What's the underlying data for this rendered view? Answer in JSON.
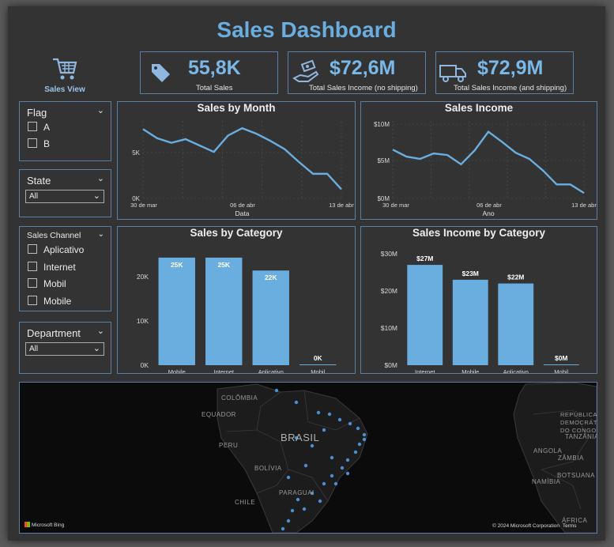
{
  "title": "Sales Dashboard",
  "nav": {
    "label": "Sales View",
    "icon": "shopping-cart-icon"
  },
  "kpis": [
    {
      "value": "55,8K",
      "label": "Total Sales",
      "icon": "price-tag-icon"
    },
    {
      "value": "$72,6M",
      "label": "Total Sales Income (no shipping)",
      "icon": "hand-money-icon"
    },
    {
      "value": "$72,9M",
      "label": "Total Sales Income (and shipping)",
      "icon": "delivery-truck-icon"
    }
  ],
  "slicers": {
    "flag": {
      "title": "Flag",
      "options": [
        "A",
        "B"
      ]
    },
    "state": {
      "title": "State",
      "selected": "All"
    },
    "sales_channel": {
      "title": "Sales Channel",
      "options": [
        "Aplicativo",
        "Internet",
        "Mobil",
        "Mobile"
      ]
    },
    "department": {
      "title": "Department",
      "selected": "All"
    }
  },
  "colors": {
    "accent": "#6aaedf",
    "bar": "#6aaee0",
    "border": "#5b7fa3",
    "background": "#333333"
  },
  "chart_data": [
    {
      "type": "line",
      "title": "Sales by Month",
      "xlabel": "Data",
      "ylabel": "",
      "x_ticks": [
        "30 de mar",
        "06 de abr",
        "13 de abr"
      ],
      "y_ticks": [
        "0K",
        "5K"
      ],
      "ylim": [
        0,
        8500
      ],
      "values": [
        7600,
        6600,
        6100,
        6500,
        5800,
        5100,
        6900,
        7700,
        7100,
        6300,
        5400,
        4000,
        2700,
        2700,
        1000
      ],
      "grid": true
    },
    {
      "type": "line",
      "title": "Sales Income",
      "xlabel": "Ano",
      "ylabel": "",
      "x_ticks": [
        "30 de mar",
        "06 de abr",
        "13 de abr"
      ],
      "y_ticks": [
        "$0M",
        "$5M",
        "$10M"
      ],
      "ylim": [
        0,
        10000000
      ],
      "values": [
        6300000,
        5400000,
        5100000,
        5800000,
        5600000,
        4400000,
        6200000,
        8600000,
        7300000,
        5900000,
        5100000,
        3600000,
        1800000,
        1800000,
        700000
      ],
      "grid": true
    },
    {
      "type": "bar",
      "title": "Sales by Category",
      "categories": [
        "Mobile",
        "Internet",
        "Aplicativo",
        "Mobil"
      ],
      "values": [
        25000,
        25000,
        22000,
        0
      ],
      "data_labels": [
        "25K",
        "25K",
        "22K",
        "0K"
      ],
      "y_ticks": [
        "0K",
        "10K",
        "20K"
      ],
      "ylim": [
        0,
        27000
      ]
    },
    {
      "type": "bar",
      "title": "Sales Income by Category",
      "categories": [
        "Internet",
        "Mobile",
        "Aplicativo",
        "Mobil"
      ],
      "values": [
        27000000,
        23000000,
        22000000,
        0
      ],
      "data_labels": [
        "$27M",
        "$23M",
        "$22M",
        "$0M"
      ],
      "y_ticks": [
        "$0M",
        "$10M",
        "$20M",
        "$30M"
      ],
      "ylim": [
        0,
        30000000
      ]
    }
  ],
  "map": {
    "labels": [
      "COLÔMBIA",
      "EQUADOR",
      "PERU",
      "BRASIL",
      "BOLÍVIA",
      "PARAGUAI",
      "CHILE",
      "REPÚBLICA DEMOCRÁTICA DO CONGO",
      "TANZÂNIA",
      "ANGOLA",
      "ZÂMBIA",
      "NAMÍBIA",
      "BOTSUANA",
      "ÁFRICA"
    ],
    "attribution": "Microsoft Bing",
    "copyright": "© 2024 Microsoft Corporation",
    "terms": "Terms"
  }
}
